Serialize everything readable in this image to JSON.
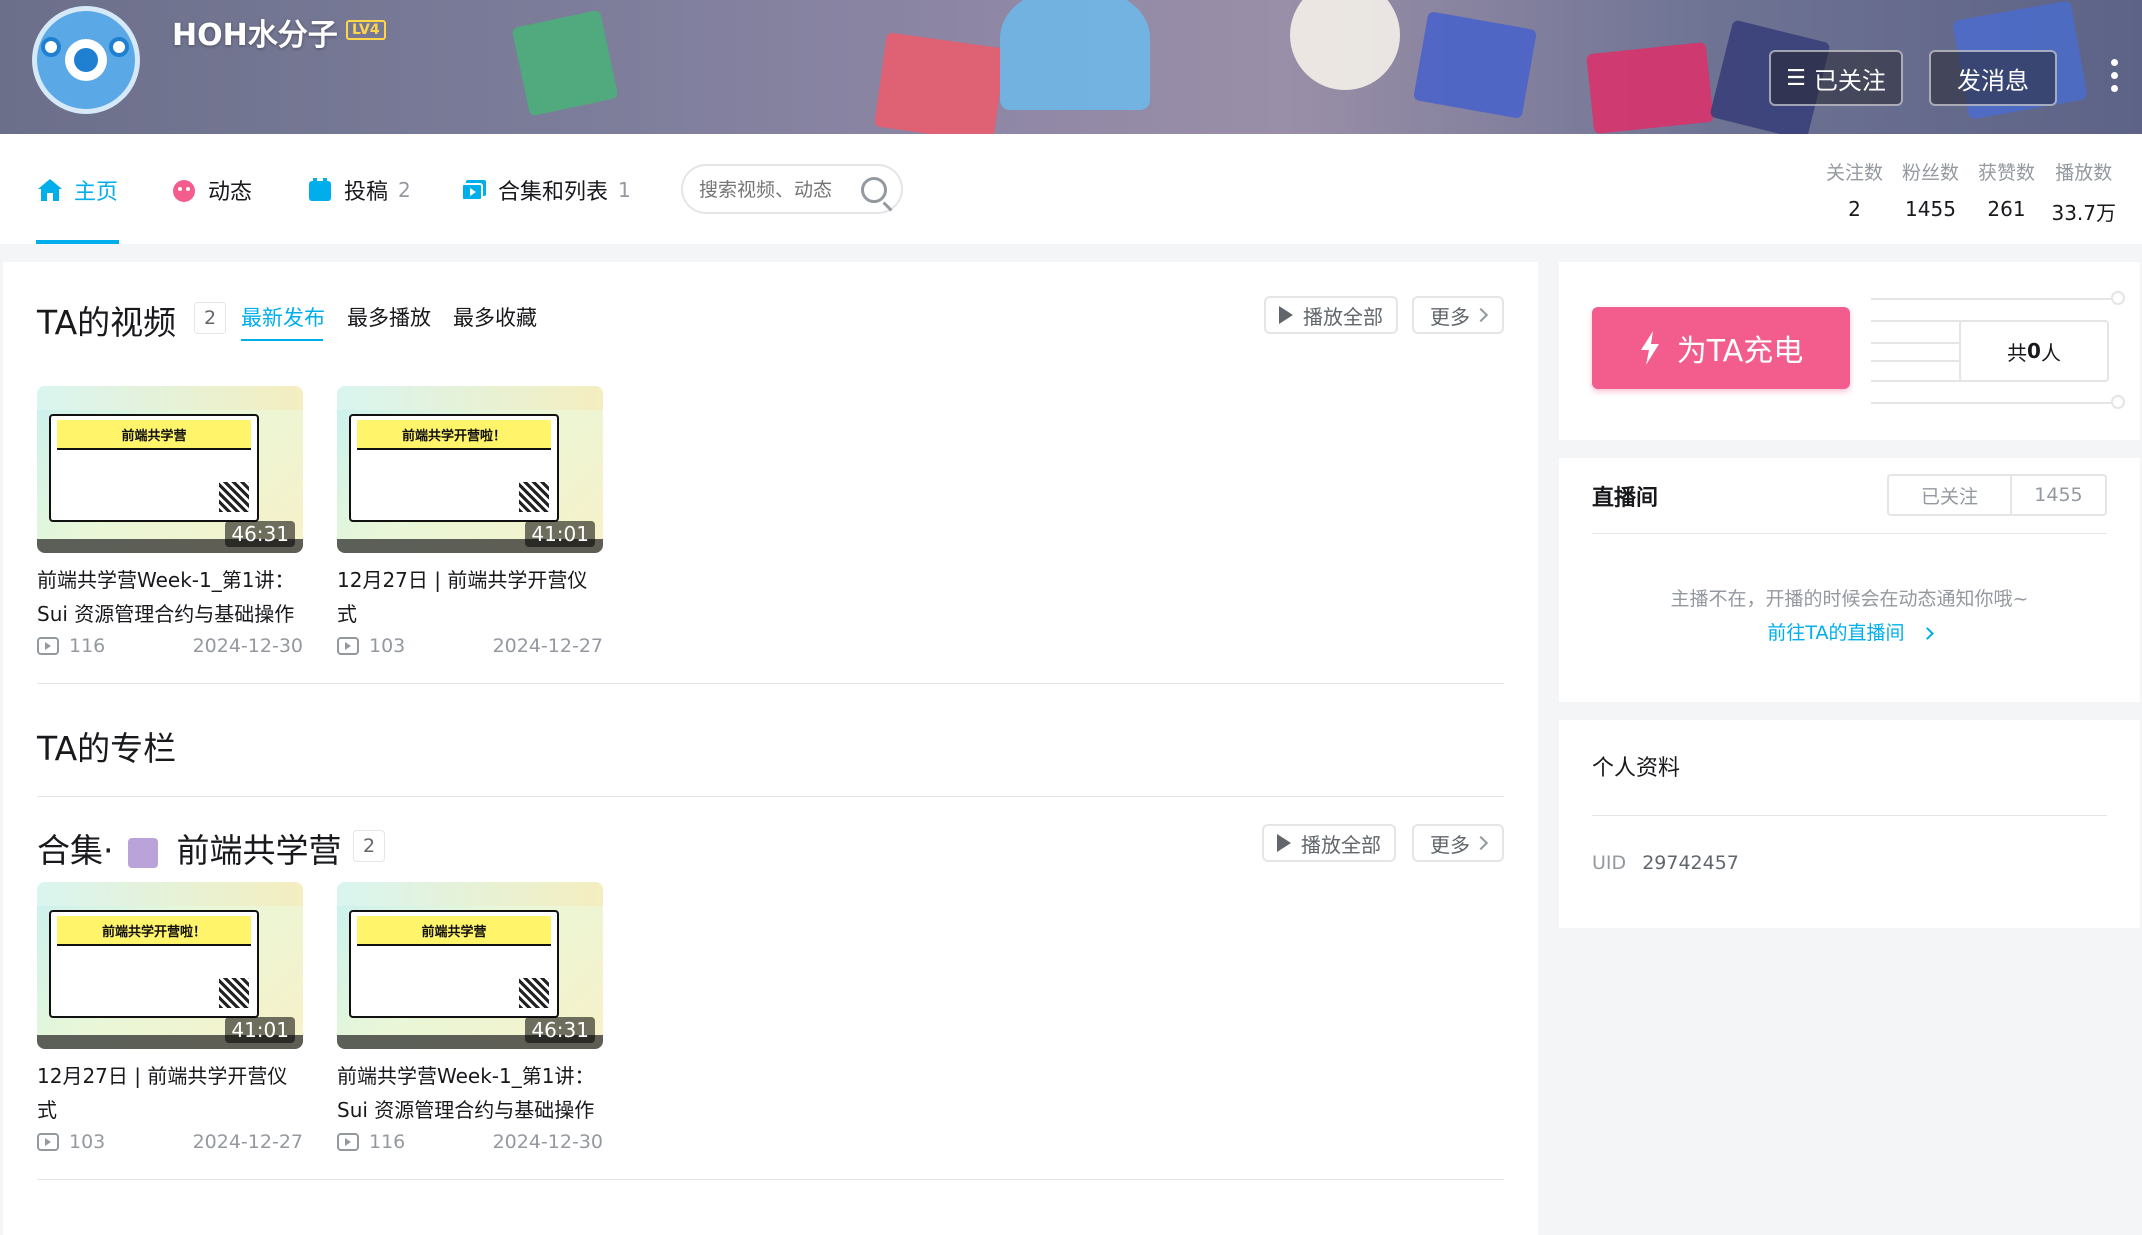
{
  "header": {
    "username": "HOH水分子",
    "level": "LV4",
    "follow_button": "已关注",
    "message_button": "发消息"
  },
  "nav": {
    "tabs": [
      {
        "label": "主页",
        "count": ""
      },
      {
        "label": "动态",
        "count": ""
      },
      {
        "label": "投稿",
        "count": "2"
      },
      {
        "label": "合集和列表",
        "count": "1"
      }
    ],
    "search_placeholder": "搜索视频、动态",
    "stats": [
      {
        "label": "关注数",
        "value": "2"
      },
      {
        "label": "粉丝数",
        "value": "1455"
      },
      {
        "label": "获赞数",
        "value": "261"
      },
      {
        "label": "播放数",
        "value": "33.7万"
      }
    ]
  },
  "videos_section": {
    "title": "TA的视频",
    "count": "2",
    "sort_tabs": [
      "最新发布",
      "最多播放",
      "最多收藏"
    ],
    "play_all": "播放全部",
    "more": "更多",
    "items": [
      {
        "thumb_headline": "前端共学营",
        "duration": "46:31",
        "title": "前端共学营Week-1_第1讲：Sui 资源管理合约与基础操作",
        "plays": "116",
        "date": "2024-12-30"
      },
      {
        "thumb_headline": "前端共学开营啦！",
        "duration": "41:01",
        "title": "12月27日 | 前端共学开营仪式",
        "plays": "103",
        "date": "2024-12-27"
      }
    ]
  },
  "column_section": {
    "title": "TA的专栏"
  },
  "collection_section": {
    "title_prefix": "合集·",
    "title_name": "前端共学营",
    "count": "2",
    "play_all": "播放全部",
    "more": "更多",
    "items": [
      {
        "thumb_headline": "前端共学开营啦！",
        "duration": "41:01",
        "title": "12月27日 | 前端共学开营仪式",
        "plays": "103",
        "date": "2024-12-27"
      },
      {
        "thumb_headline": "前端共学营",
        "duration": "46:31",
        "title": "前端共学营Week-1_第1讲：Sui 资源管理合约与基础操作",
        "plays": "116",
        "date": "2024-12-30"
      }
    ]
  },
  "charge": {
    "button": "为TA充电",
    "total_prefix": "共",
    "total_value": "0",
    "total_suffix": "人"
  },
  "live": {
    "title": "直播间",
    "follow_state": "已关注",
    "follower_count": "1455",
    "offline_msg": "主播不在，开播的时候会在动态通知你哦~",
    "goto_link": "前往TA的直播间"
  },
  "profile": {
    "title": "个人资料",
    "uid_label": "UID",
    "uid_value": "29742457"
  },
  "colors": {
    "accent": "#00aeec",
    "charge_pink": "#f25d8e",
    "text_muted": "#9499a0"
  }
}
